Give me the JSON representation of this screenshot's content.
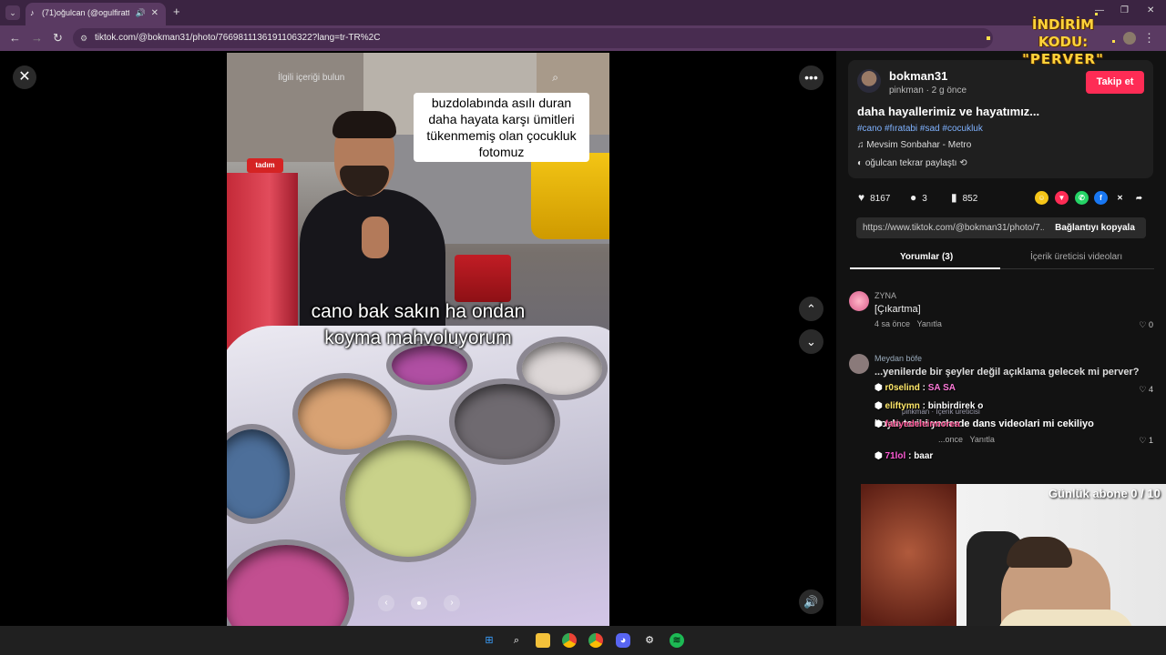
{
  "browser": {
    "tab_title": "(71)oğulcan (@ogulfiratt) |",
    "url": "tiktok.com/@bokman31/photo/7669811136191106322?lang=tr-TR%2C",
    "promo_line1": "İNDİRİM KODU:",
    "promo_line2": "\"PERVER\""
  },
  "viewer": {
    "related_search": "İlgili içeriği bulun",
    "top_caption_lines": [
      "buzdolabında asılı duran",
      "daha hayata karşı ümitleri",
      "tükenmemiş olan çocukluk",
      "fotomuz"
    ],
    "mid_caption_lines": [
      "cano bak sakın ha ondan",
      "koyma mahvoluyorum"
    ]
  },
  "post": {
    "author": "bokman31",
    "meta": "pinkman · 2 g önce",
    "follow_label": "Takip et",
    "title": "daha hayallerimiz ve hayatımız...",
    "hashtags": "#cano #fıratabi #sad #cocukluk",
    "music": "Mevsim Sonbahar - Metro",
    "repost": "oğulcan tekrar paylaştı",
    "likes": "8167",
    "comments": "3",
    "saves": "852",
    "link": "https://www.tiktok.com/@bokman31/photo/7...",
    "copy_label": "Bağlantıyı kopyala",
    "tab_comments": "Yorumlar (3)",
    "tab_creator": "İçerik üreticisi videoları"
  },
  "comments": [
    {
      "user": "ZYNA",
      "text": "[Çıkartma]",
      "time": "4 sa önce",
      "reply": "Yanıtla",
      "likes": "0"
    },
    {
      "user": "Meydan böfe",
      "text": "...yenilerde bir şeyler değil açıklama gelecek mi perver?",
      "likes": "4"
    },
    {
      "user": "pinkman · İçerik üreticisi",
      "text": "boyle tarihi yerlerde dans videolari mi cekiliyo",
      "time": "...once",
      "reply": "Yanıtla",
      "likes": "1"
    }
  ],
  "chat": [
    {
      "user": "r0selind",
      "msg": "SA SA"
    },
    {
      "user": "eliftymn",
      "msg": ": binbirdirek o"
    },
    {
      "user": "fatiyedeleinnorea",
      "msg": ""
    },
    {
      "user": "71lol",
      "msg": ": baar"
    }
  ],
  "overlay": {
    "sub_counter": "Günlük abone 0 / 10"
  },
  "colors": {
    "accent": "#fe2c55",
    "hashtag": "#7fb2ff",
    "chrome": "#5a3a62"
  }
}
